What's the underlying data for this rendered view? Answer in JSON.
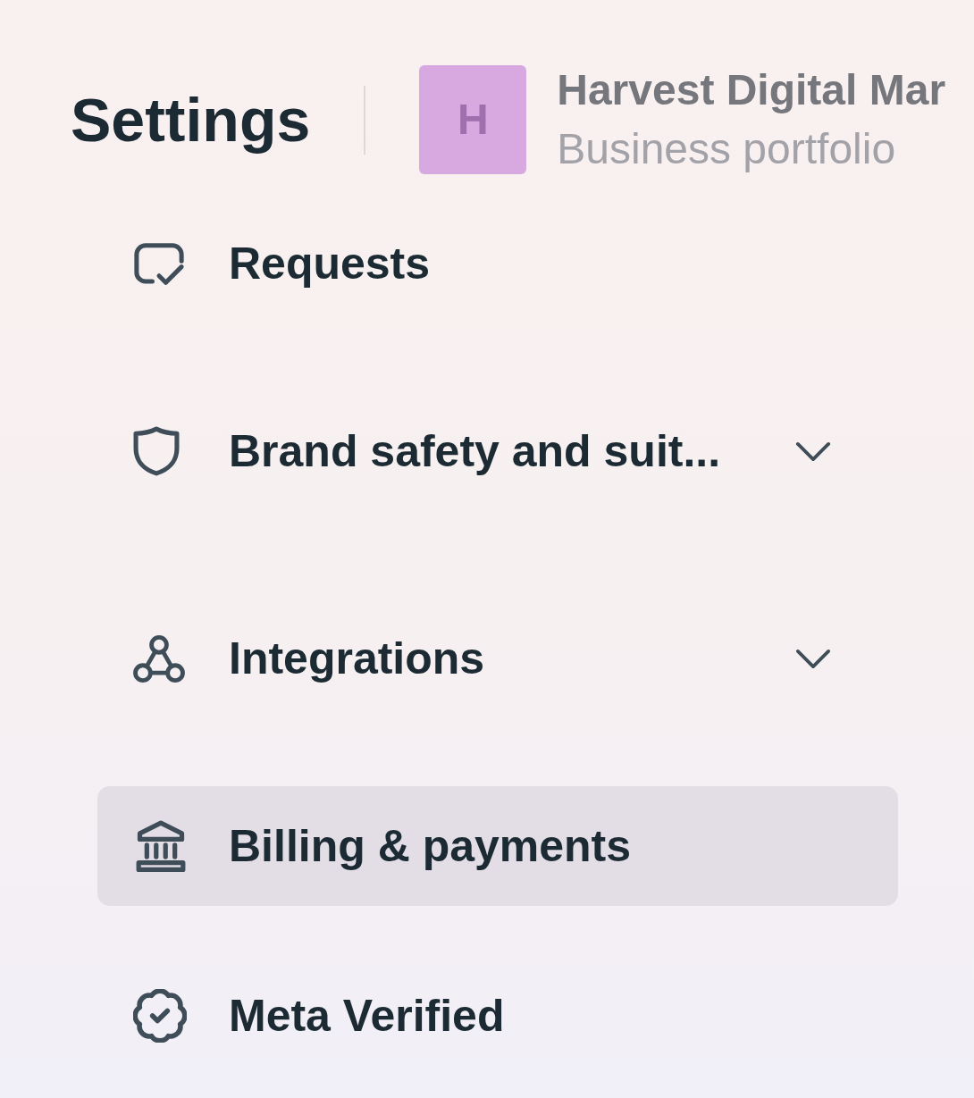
{
  "header": {
    "title": "Settings",
    "account": {
      "avatar_letter": "H",
      "name": "Harvest Digital Mar",
      "subtitle": "Business portfolio"
    }
  },
  "sidebar": {
    "items": [
      {
        "label": "Requests",
        "kind": "link",
        "selected": false
      },
      {
        "label": "Brand safety and suit...",
        "kind": "group",
        "expanded": false,
        "selected": false
      },
      {
        "label": "Integrations",
        "kind": "group",
        "expanded": false,
        "selected": false
      },
      {
        "label": "Billing & payments",
        "kind": "link",
        "selected": true
      },
      {
        "label": "Meta Verified",
        "kind": "link",
        "selected": false
      }
    ]
  }
}
